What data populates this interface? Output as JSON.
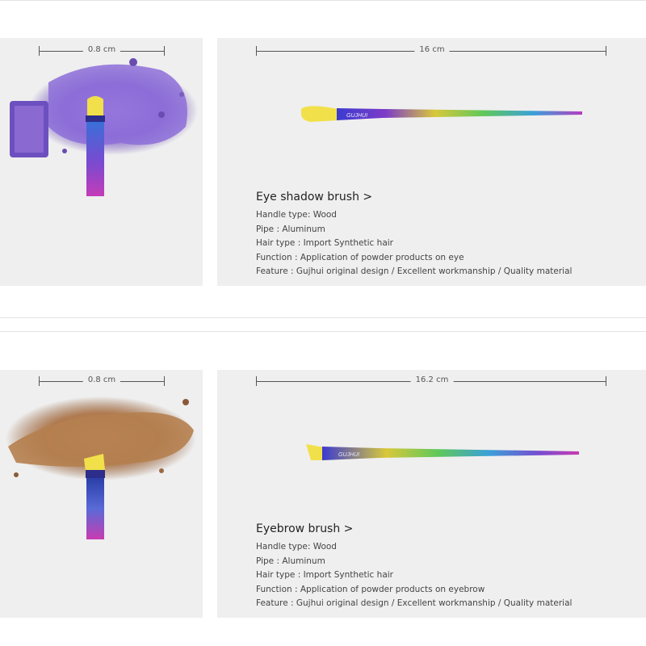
{
  "products": [
    {
      "small_dimension": "0.8 cm",
      "length_dimension": "16 cm",
      "title": "Eye shadow brush >",
      "specs": [
        "Handle type: Wood",
        "Pipe : Aluminum",
        "Hair type : Import Synthetic hair",
        "Function : Application of powder products on eye",
        "Feature : Gujhui original design / Excellent workmanship / Quality material"
      ],
      "swatch_color": "#7f5fc8"
    },
    {
      "small_dimension": "0.8 cm",
      "length_dimension": "16.2 cm",
      "title": "Eyebrow brush >",
      "specs": [
        "Handle type: Wood",
        "Pipe : Aluminum",
        "Hair type : Import Synthetic hair",
        "Function : Application of powder products on eyebrow",
        "Feature : Gujhui original design / Excellent workmanship / Quality material"
      ],
      "swatch_color": "#b07a4f"
    }
  ],
  "brand_mark": "GUJHUI",
  "colors": {
    "bristle": "#f2e04a",
    "panel": "#efefef"
  }
}
